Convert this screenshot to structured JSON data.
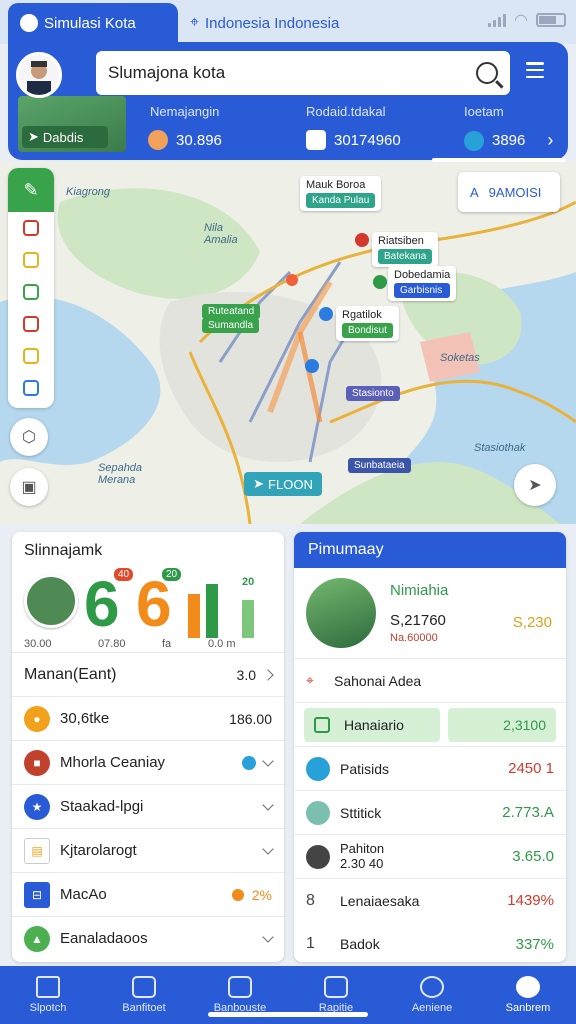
{
  "tabs": [
    {
      "label": "Simulasi Kota"
    },
    {
      "label": "Indonesia Indonesia"
    }
  ],
  "header": {
    "search_value": "Slumajona kota",
    "gps_label": "Dabdis",
    "stats": [
      {
        "label": "Nemajangin",
        "value": "30.896",
        "color": "#f2a15a"
      },
      {
        "label": "Rodaid.tdakal",
        "value": "30174960",
        "color": "#2a5bd7"
      },
      {
        "label": "Ioetam",
        "value": "3896",
        "color": "#28a0d8"
      }
    ]
  },
  "map": {
    "area_button": "9AMOISI",
    "nav_button": "FLOON",
    "labels": [
      {
        "text": "Mauk Boroa",
        "tag": "Kanda Pulau"
      },
      {
        "text": "Riatsiben",
        "tag": "Batekana"
      },
      {
        "text": "Dobedamia",
        "tag": "Garbisnis"
      },
      {
        "text": "Rgatilok",
        "tag": "Bondisut"
      },
      {
        "text": "Ruteatand",
        "tag": "Sumandla"
      }
    ],
    "regions": [
      "Kiagrong",
      "Nila Amalia",
      "Sepahda Merana",
      "Stasiothak",
      "Soketas",
      "Stasionto",
      "Sunbataeia"
    ]
  },
  "left_panel": {
    "title": "Slinnajamk",
    "big_num_1": "6",
    "big_num_2": "6",
    "badge_1": "40",
    "badge_2": "20",
    "sub_1": "30.00",
    "sub_2": "07.80",
    "sub_3": "fa",
    "sub_4": "0.0 m",
    "rows": [
      {
        "label": "Manan(Eant)",
        "value": "3.0",
        "icon_color": "",
        "chev": "right"
      },
      {
        "label": "30,6tke",
        "value": "186.00",
        "icon_color": "#f2a21a"
      },
      {
        "label": "Mhorla Ceaniay",
        "value": "",
        "icon_color": "#c2412d"
      },
      {
        "label": "Staakad-lpgi",
        "value": "",
        "icon_color": "#2a5bd7"
      },
      {
        "label": "Kjtarolarogt",
        "value": "",
        "icon_color": "#f2a21a"
      },
      {
        "label": "MacAo",
        "value": "2%",
        "icon_color": "#2a5bd7"
      },
      {
        "label": "Eanaladaoos",
        "value": "",
        "icon_color": "#4caf50"
      }
    ]
  },
  "right_panel": {
    "title": "Pimumaay",
    "card_title": "Nimiahia",
    "card_line1": "S,21760",
    "card_line2": "Na.60000",
    "card_value": "S,230",
    "rows": [
      {
        "label": "Sahonai Adea",
        "value": ""
      },
      {
        "label": "Hanaiario",
        "value": "2,3100"
      },
      {
        "label": "Patisids",
        "value": "2450 1"
      },
      {
        "label": "Sttitick",
        "value": "2.773.A"
      },
      {
        "label": "Pahiton 2.30 40",
        "value": "3.65.0"
      },
      {
        "label": "Lenaiaesaka",
        "value": "1439%"
      },
      {
        "label": "Badok",
        "value": "337%"
      }
    ]
  },
  "bottom_nav": [
    {
      "label": "Slpotch"
    },
    {
      "label": "Banfitoet"
    },
    {
      "label": "Banbouste"
    },
    {
      "label": "Rapitie"
    },
    {
      "label": "Aeniene"
    },
    {
      "label": "Sanbrem"
    }
  ]
}
